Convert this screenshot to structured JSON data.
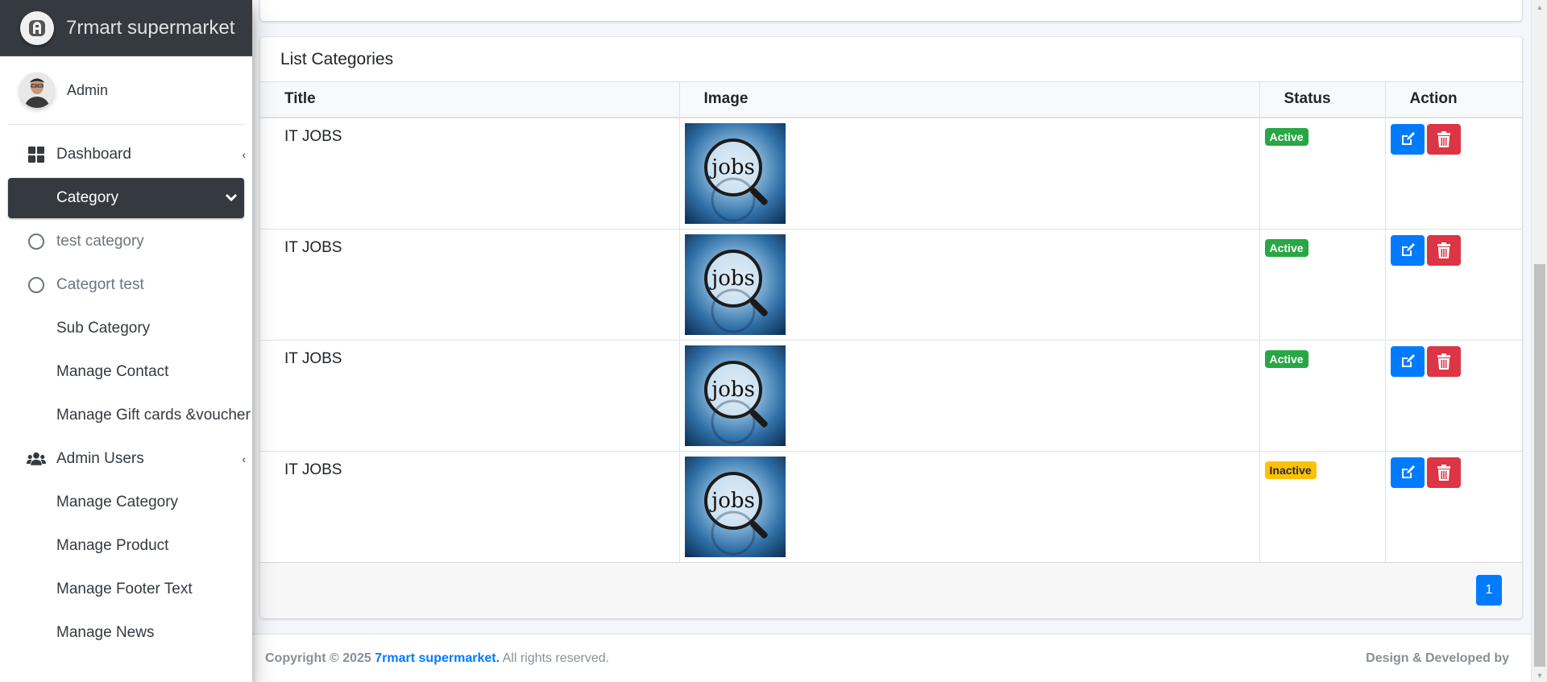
{
  "brand": {
    "name": "7rmart supermarket"
  },
  "user": {
    "name": "Admin"
  },
  "sidebar": {
    "items": [
      {
        "label": "Dashboard",
        "icon": "dashboard-icon"
      },
      {
        "label": "Category",
        "icon": "none",
        "active": true
      },
      {
        "label": "test category",
        "icon": "circle-icon"
      },
      {
        "label": "Categort test",
        "icon": "circle-icon"
      },
      {
        "label": "Sub Category"
      },
      {
        "label": "Manage Contact"
      },
      {
        "label": "Manage Gift cards &voucher"
      },
      {
        "label": "Admin Users",
        "icon": "users-icon"
      },
      {
        "label": "Manage Category"
      },
      {
        "label": "Manage Product"
      },
      {
        "label": "Manage Footer Text"
      },
      {
        "label": "Manage News"
      }
    ]
  },
  "card": {
    "title": "List Categories",
    "columns": [
      "Title",
      "Image",
      "Status",
      "Action"
    ],
    "rows": [
      {
        "title": "IT JOBS",
        "image_text": "jobs",
        "status": "Active"
      },
      {
        "title": "IT JOBS",
        "image_text": "jobs",
        "status": "Active"
      },
      {
        "title": "IT JOBS",
        "image_text": "jobs",
        "status": "Active"
      },
      {
        "title": "IT JOBS",
        "image_text": "jobs",
        "status": "Inactive"
      }
    ],
    "pagination": {
      "current": "1"
    }
  },
  "footer": {
    "copyright_prefix": "Copyright © 2025",
    "brand_link": "7rmart supermarket.",
    "rights": "All rights reserved.",
    "right_text": "Design & Developed by"
  },
  "colors": {
    "sidebar_active": "#343a40",
    "primary": "#007bff",
    "success": "#28a745",
    "warning": "#ffc107",
    "danger": "#dc3545"
  }
}
